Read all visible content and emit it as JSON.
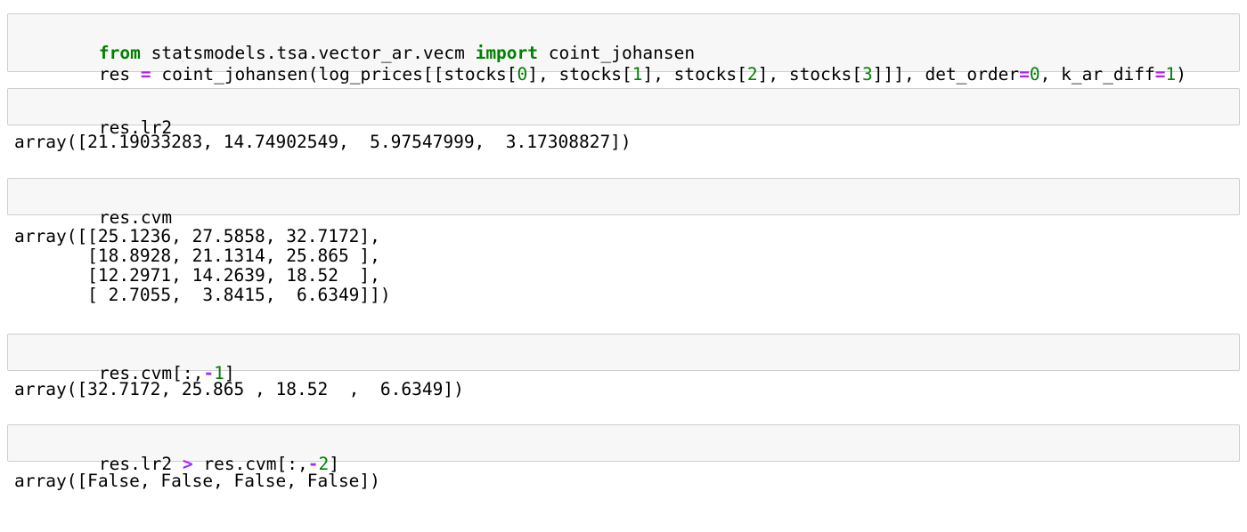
{
  "cells": [
    {
      "input_lines": [
        [
          {
            "text": "from",
            "cls": "kw"
          },
          {
            "text": " statsmodels.tsa.vector_ar.vecm ",
            "cls": ""
          },
          {
            "text": "import",
            "cls": "kw"
          },
          {
            "text": " coint_johansen",
            "cls": ""
          }
        ],
        [
          {
            "text": "res ",
            "cls": ""
          },
          {
            "text": "=",
            "cls": "op"
          },
          {
            "text": " coint_johansen(log_prices[[stocks[",
            "cls": ""
          },
          {
            "text": "0",
            "cls": "num"
          },
          {
            "text": "], stocks[",
            "cls": ""
          },
          {
            "text": "1",
            "cls": "num"
          },
          {
            "text": "], stocks[",
            "cls": ""
          },
          {
            "text": "2",
            "cls": "num"
          },
          {
            "text": "], stocks[",
            "cls": ""
          },
          {
            "text": "3",
            "cls": "num"
          },
          {
            "text": "]]], det_order",
            "cls": ""
          },
          {
            "text": "=",
            "cls": "op"
          },
          {
            "text": "0",
            "cls": "num"
          },
          {
            "text": ", k_ar_diff",
            "cls": ""
          },
          {
            "text": "=",
            "cls": "op"
          },
          {
            "text": "1",
            "cls": "num"
          },
          {
            "text": ")",
            "cls": ""
          }
        ]
      ],
      "output_lines": []
    },
    {
      "input_lines": [
        [
          {
            "text": "res.lr2",
            "cls": ""
          }
        ]
      ],
      "output_lines": [
        "array([21.19033283, 14.74902549,  5.97547999,  3.17308827])"
      ]
    },
    {
      "input_lines": [
        [
          {
            "text": "res.cvm",
            "cls": ""
          }
        ]
      ],
      "output_lines": [
        "array([[25.1236, 27.5858, 32.7172],",
        "       [18.8928, 21.1314, 25.865 ],",
        "       [12.2971, 14.2639, 18.52  ],",
        "       [ 2.7055,  3.8415,  6.6349]])"
      ]
    },
    {
      "input_lines": [
        [
          {
            "text": "res.cvm[:,",
            "cls": ""
          },
          {
            "text": "-",
            "cls": "op"
          },
          {
            "text": "1",
            "cls": "num"
          },
          {
            "text": "]",
            "cls": ""
          }
        ]
      ],
      "output_lines": [
        "array([32.7172, 25.865 , 18.52  ,  6.6349])"
      ]
    },
    {
      "input_lines": [
        [
          {
            "text": "res.lr2 ",
            "cls": ""
          },
          {
            "text": ">",
            "cls": "op"
          },
          {
            "text": " res.cvm[:,",
            "cls": ""
          },
          {
            "text": "-",
            "cls": "op"
          },
          {
            "text": "2",
            "cls": "num"
          },
          {
            "text": "]",
            "cls": ""
          }
        ]
      ],
      "output_lines": [
        "array([False, False, False, False])"
      ]
    }
  ]
}
